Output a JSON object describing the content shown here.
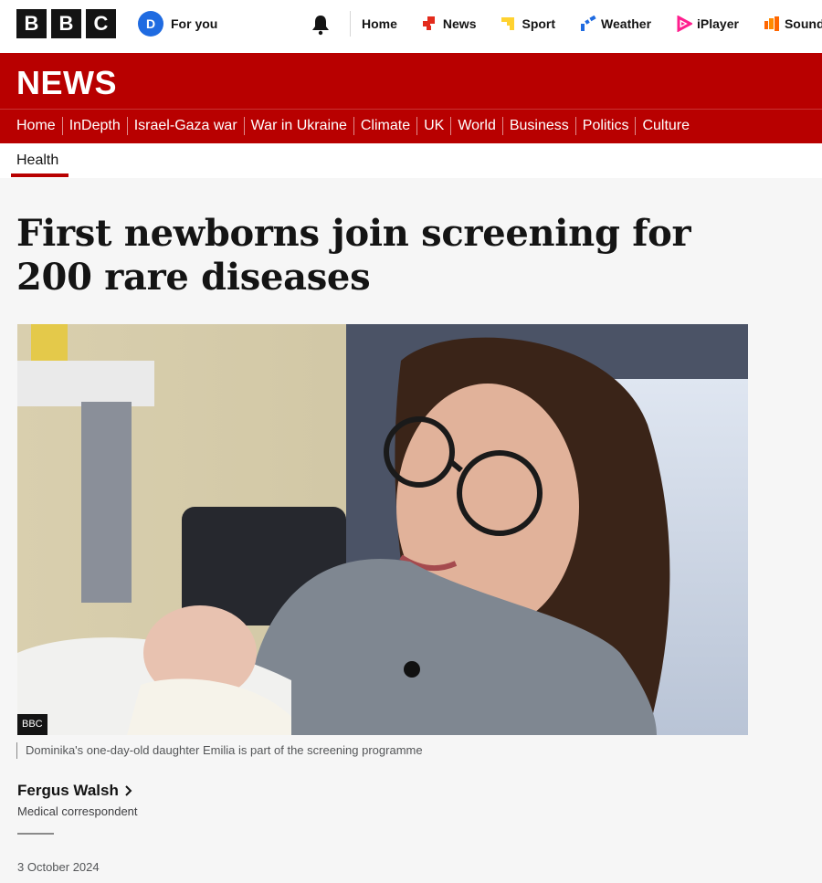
{
  "masthead": {
    "logo_letters": [
      "B",
      "B",
      "C"
    ],
    "avatar_initial": "D",
    "for_you_label": "For you",
    "nav": [
      {
        "label": "Home",
        "icon": "home"
      },
      {
        "label": "News",
        "icon": "news-icon",
        "color": "#e32b1c"
      },
      {
        "label": "Sport",
        "icon": "sport-icon",
        "color": "#ffd230"
      },
      {
        "label": "Weather",
        "icon": "weather-icon",
        "color": "#1f6be1"
      },
      {
        "label": "iPlayer",
        "icon": "iplayer-icon",
        "color": "#ff1e8e"
      },
      {
        "label": "Sounds",
        "icon": "sounds-icon",
        "color": "#ff6600"
      }
    ]
  },
  "news_banner": {
    "title": "NEWS",
    "brand_color": "#b80000"
  },
  "section_nav": [
    "Home",
    "InDepth",
    "Israel-Gaza war",
    "War in Ukraine",
    "Climate",
    "UK",
    "World",
    "Business",
    "Politics",
    "Culture"
  ],
  "subnav": {
    "active": "Health"
  },
  "article": {
    "headline": "First newborns join screening for 200 rare diseases",
    "image_credit": "BBC",
    "caption": "Dominika's one-day-old daughter Emilia is part of the screening programme",
    "author_name": "Fergus Walsh",
    "author_role": "Medical correspondent",
    "date": "3 October 2024"
  }
}
